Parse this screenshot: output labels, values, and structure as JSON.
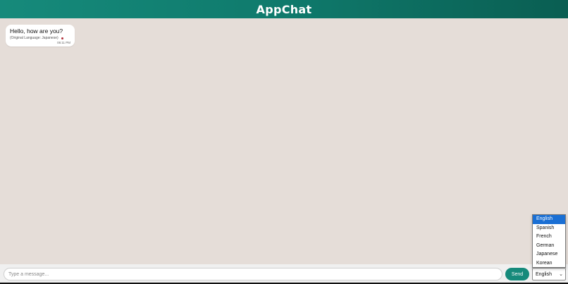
{
  "header": {
    "title": "AppChat"
  },
  "messages": [
    {
      "text": "Hello, how are you?",
      "original_language": "(Original Language: Japanese)",
      "time": "06:11 PM"
    }
  ],
  "composer": {
    "placeholder": "Type a message...",
    "send_label": "Send",
    "language_selected": "English"
  },
  "language_dropdown": {
    "options": [
      "English",
      "Spanish",
      "French",
      "German",
      "Japanese",
      "Korean"
    ],
    "highlighted_index": 0
  },
  "colors": {
    "header_gradient_start": "#168a7b",
    "header_gradient_end": "#0a5e52",
    "chat_background": "#e5ddd8",
    "send_button": "#168a7b",
    "dropdown_highlight": "#1a6fd4",
    "language_dot": "#b0303a"
  },
  "icons": {
    "select_chevron": "chevron-down-icon",
    "language_indicator": "dot-icon"
  }
}
